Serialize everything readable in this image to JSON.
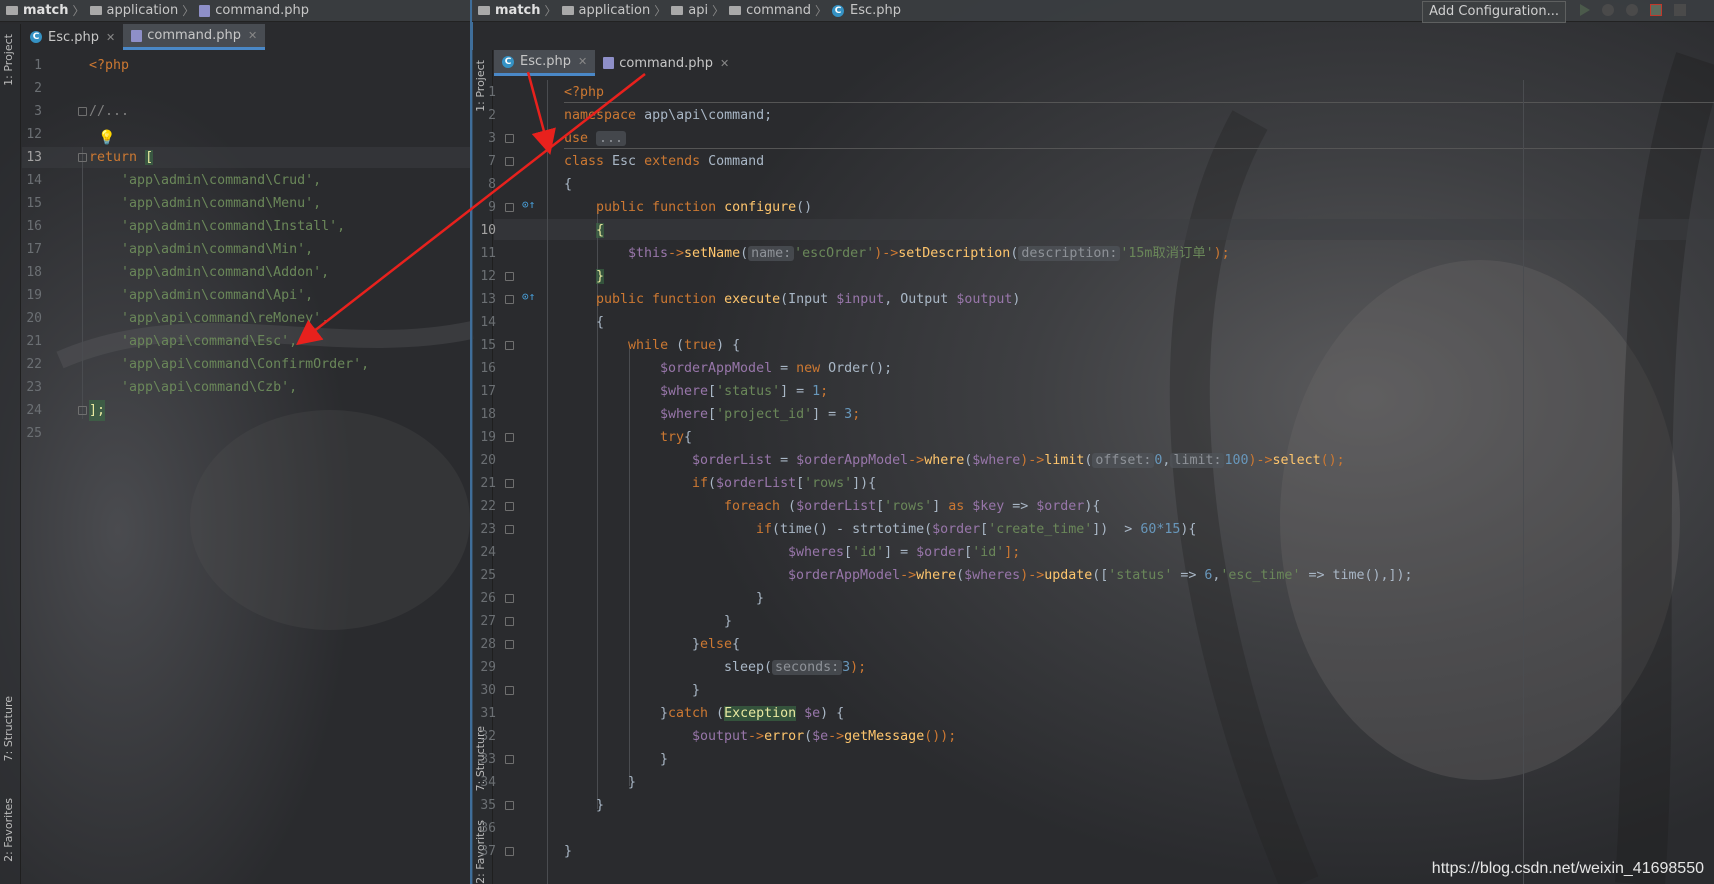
{
  "left": {
    "breadcrumb": [
      "match",
      "application",
      "command.php"
    ],
    "tabs": [
      {
        "label": "Esc.php",
        "active": false
      },
      {
        "label": "command.php",
        "active": true
      }
    ],
    "side_labels": [
      "1: Project",
      "7: Structure",
      "2: Favorites"
    ],
    "line_numbers": [
      "1",
      "2",
      "3",
      "12",
      "13",
      "14",
      "15",
      "16",
      "17",
      "18",
      "19",
      "20",
      "21",
      "22",
      "23",
      "24",
      "25"
    ],
    "code": {
      "l1": "<?php",
      "l3": "//...",
      "l13_kw": "return",
      "l13_br": "[",
      "items": [
        "'app\\admin\\command\\Crud',",
        "'app\\admin\\command\\Menu',",
        "'app\\admin\\command\\Install',",
        "'app\\admin\\command\\Min',",
        "'app\\admin\\command\\Addon',",
        "'app\\admin\\command\\Api',",
        "'app\\api\\command\\reMoney',",
        "'app\\api\\command\\Esc',",
        "'app\\api\\command\\ConfirmOrder',",
        "'app\\api\\command\\Czb',"
      ],
      "l24": "];"
    }
  },
  "right": {
    "breadcrumb": [
      "match",
      "application",
      "api",
      "command",
      "Esc.php"
    ],
    "tabs": [
      {
        "label": "Esc.php",
        "active": true
      },
      {
        "label": "command.php",
        "active": false
      }
    ],
    "toolbar": {
      "add_configuration": "Add Configuration..."
    },
    "side_labels": [
      "1: Project",
      "7: Structure",
      "2: Favorites"
    ],
    "line_numbers": [
      "1",
      "2",
      "3",
      "7",
      "8",
      "9",
      "10",
      "11",
      "12",
      "13",
      "14",
      "15",
      "16",
      "17",
      "18",
      "19",
      "20",
      "21",
      "22",
      "23",
      "24",
      "25",
      "26",
      "27",
      "28",
      "29",
      "30",
      "31",
      "32",
      "33",
      "34",
      "35",
      "36",
      "37"
    ],
    "code": {
      "c1": "<?php",
      "c2_kw": "namespace",
      "c2_rest": " app\\api\\command;",
      "c3_kw": "use",
      "c3_fold": "...",
      "c7_a": "class",
      "c7_b": " Esc ",
      "c7_c": "extends",
      "c7_d": " Command",
      "c8": "{",
      "c9_a": "    public function ",
      "c9_b": "configure",
      "c9_c": "()",
      "c10": "{",
      "c11_var": "$this",
      "c11_a": "->",
      "c11_fn1": "setName",
      "c11_p1": "(",
      "c11_h1": "name:",
      "c11_s1": "'escOrder'",
      "c11_b": ")->",
      "c11_fn2": "setDescription",
      "c11_p2": "(",
      "c11_h2": "description:",
      "c11_s2": "'15m取消订单'",
      "c11_end": ");",
      "c12": "}",
      "c13_a": "    public function ",
      "c13_b": "execute",
      "c13_c": "(Input ",
      "c13_v1": "$input",
      "c13_d": ", Output ",
      "c13_v2": "$output",
      "c13_e": ")",
      "c14": "    {",
      "c15_a": "        while ",
      "c15_b": "(",
      "c15_c": "true",
      "c15_d": ") {",
      "c16_v": "$orderAppModel",
      "c16_a": " = ",
      "c16_k": "new",
      "c16_b": " Order();",
      "c17_v": "$where",
      "c17_a": "[",
      "c17_s": "'status'",
      "c17_b": "] = ",
      "c17_n": "1",
      "c17_c": ";",
      "c18_v": "$where",
      "c18_a": "[",
      "c18_s": "'project_id'",
      "c18_b": "] = ",
      "c18_n": "3",
      "c18_c": ";",
      "c19_k": "try",
      "c19_b": "{",
      "c20_v1": "$orderList",
      "c20_a": " = ",
      "c20_v2": "$orderAppModel",
      "c20_b": "->",
      "c20_f1": "where",
      "c20_c": "(",
      "c20_v3": "$where",
      "c20_d": ")->",
      "c20_f2": "limit",
      "c20_e": "(",
      "c20_h1": "offset:",
      "c20_n1": "0",
      "c20_g": ",",
      "c20_h2": "limit:",
      "c20_n2": "100",
      "c20_i": ")->",
      "c20_f3": "select",
      "c20_j": "();",
      "c21_k": "if",
      "c21_a": "(",
      "c21_v": "$orderList",
      "c21_b": "[",
      "c21_s": "'rows'",
      "c21_c": "]){",
      "c22_k": "foreach",
      "c22_a": " (",
      "c22_v1": "$orderList",
      "c22_b": "[",
      "c22_s": "'rows'",
      "c22_c": "] ",
      "c22_k2": "as",
      "c22_v2": " $key",
      "c22_d": " => ",
      "c22_v3": "$order",
      "c22_e": "){",
      "c23_k": "if",
      "c23_a": "(time() - strtotime(",
      "c23_v": "$order",
      "c23_b": "[",
      "c23_s": "'create_time'",
      "c23_c": "])  > ",
      "c23_n": "60*15",
      "c23_d": "){",
      "c24_v1": "$wheres",
      "c24_a": "[",
      "c24_s1": "'id'",
      "c24_b": "] = ",
      "c24_v2": "$order",
      "c24_c": "[",
      "c24_s2": "'id'",
      "c24_d": "];",
      "c25_v1": "$orderAppModel",
      "c25_a": "->",
      "c25_f1": "where",
      "c25_b": "(",
      "c25_v2": "$wheres",
      "c25_c": ")->",
      "c25_f2": "update",
      "c25_d": "([",
      "c25_s1": "'status'",
      "c25_e": " => ",
      "c25_n": "6",
      "c25_f": ",",
      "c25_s2": "'esc_time'",
      "c25_g": " => time(),]);",
      "c26": "}",
      "c27": "}",
      "c28_a": "}",
      "c28_k": "else",
      "c28_b": "{",
      "c29_a": "sleep(",
      "c29_h": "seconds:",
      "c29_n": "3",
      "c29_b": ");",
      "c30": "}",
      "c31_a": "}",
      "c31_k": "catch",
      "c31_b": " (",
      "c31_ex": "Exception",
      "c31_v": " $e",
      "c31_c": ") {",
      "c32_v1": "$output",
      "c32_a": "->",
      "c32_f": "error",
      "c32_b": "(",
      "c32_v2": "$e",
      "c32_c": "->",
      "c32_f2": "getMessage",
      "c32_d": "());",
      "c33": "}",
      "c34": "}",
      "c35": "}",
      "c37": "}"
    }
  },
  "watermark": "https://blog.csdn.net/weixin_41698550",
  "colors": {
    "arrow": "#e8211d",
    "keyword": "#cc7832",
    "string": "#6a8759",
    "variable": "#9876aa",
    "number": "#6897bb",
    "function": "#ffc66d"
  }
}
